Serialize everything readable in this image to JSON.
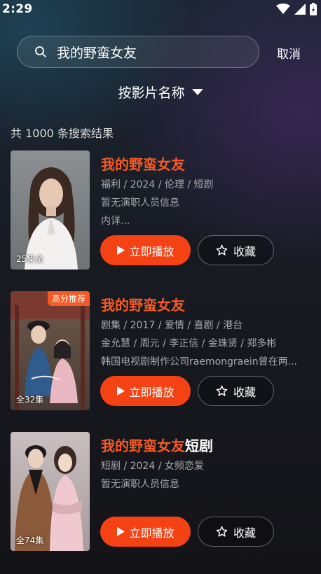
{
  "status_bar": {
    "time": "2:29"
  },
  "search": {
    "query": "我的野蛮女友",
    "cancel_label": "取消"
  },
  "sort": {
    "label": "按影片名称"
  },
  "results": {
    "count_text": "共 1000 条搜索结果",
    "items": [
      {
        "title_highlight": "我的野蛮女友",
        "title_rest": "",
        "meta1": "福利 / 2024 / 伦理 / 短剧",
        "meta2": "暂无演职人员信息",
        "meta3": "内详...",
        "episodes": "25集全",
        "badge": "",
        "play_label": "立即播放",
        "fav_label": "收藏"
      },
      {
        "title_highlight": "我的野蛮女友",
        "title_rest": "",
        "meta1": "剧集 / 2017 / 爱情 / 喜剧 / 港台",
        "meta2": "金允慧 / 周元 / 李正信 / 金珠贤 / 郑多彬",
        "meta3": "韩国电视剧制作公司raemongraein曾在两...",
        "episodes": "全32集",
        "badge": "高分推荐",
        "play_label": "立即播放",
        "fav_label": "收藏"
      },
      {
        "title_highlight": "我的野蛮女友",
        "title_rest": "短剧",
        "meta1": "短剧 / 2024 / 女频恋爱",
        "meta2": "暂无演职人员信息",
        "meta3": "",
        "episodes": "全74集",
        "badge": "",
        "play_label": "立即播放",
        "fav_label": "收藏"
      }
    ]
  },
  "colors": {
    "accent": "#f44214",
    "highlight": "#f45a25",
    "meta_text": "#a7a9ae"
  },
  "icons": [
    "wifi-icon",
    "signal-icon",
    "battery-icon",
    "search-icon",
    "caret-down-icon",
    "play-icon",
    "star-icon"
  ]
}
